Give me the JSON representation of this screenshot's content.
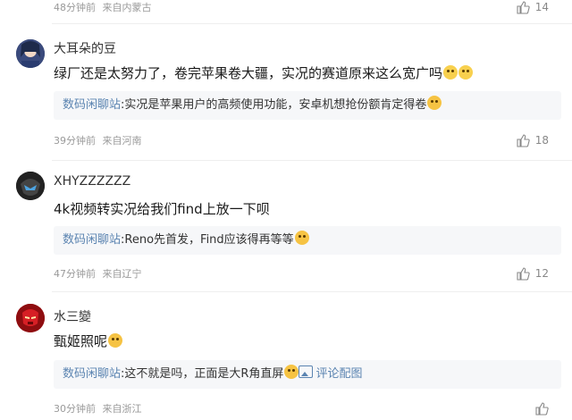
{
  "top_meta": {
    "time": "48分钟前",
    "location": "来自内蒙古",
    "likes": "14"
  },
  "comments": [
    {
      "username": "大耳朵的豆",
      "text": "绿厂还是太努力了，卷完苹果卷大疆，实况的赛道原来这么宽广吗",
      "reply_author": "数码闲聊站",
      "reply_text": ":实况是苹果用户的高频使用功能，安卓机想抢份额肯定得卷",
      "time": "39分钟前",
      "location": "来自河南",
      "likes": "18",
      "avatar_color": "#2c3a66"
    },
    {
      "username": "XHYZZZZZZ",
      "text": "4k视频转实况给我们find上放一下呗",
      "reply_author": "数码闲聊站",
      "reply_text": ":Reno先首发，Find应该得再等等",
      "time": "47分钟前",
      "location": "来自辽宁",
      "likes": "12",
      "avatar_color": "#1a1a1a"
    },
    {
      "username": "水三變",
      "text": "甄姬照呢",
      "reply_author": "数码闲聊站",
      "reply_text": ":这不就是吗，正面是大R角直屏",
      "reply_link": "评论配图",
      "time": "30分钟前",
      "location": "来自浙江",
      "avatar_color": "#c0161b"
    }
  ]
}
